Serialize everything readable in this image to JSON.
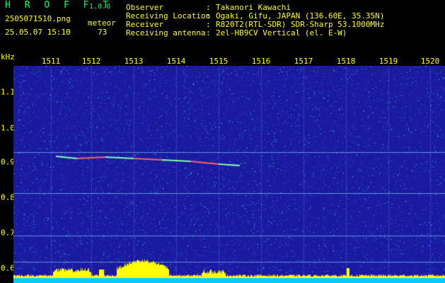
{
  "header": {
    "app_title": "H R O F F T",
    "version": "1.0.0",
    "filename": "2505071510.png",
    "datetime": "25.05.07 15:10",
    "meteor_label": "meteor",
    "meteor_count": "73"
  },
  "info": [
    {
      "label": "Observer",
      "value": "Takanori Kawachi"
    },
    {
      "label": "Receiving Location",
      "value": "Ogaki, Gifu, JAPAN (136.60E, 35.35N)"
    },
    {
      "label": "Receiver",
      "value": "R820T2(RTL-SDR) SDR-Sharp 53.1000MHz"
    },
    {
      "label": "Receiving antenna",
      "value": "2el-HB9CV Vertical (el. E-W)"
    }
  ],
  "axis": {
    "y_unit": "kHz",
    "x_ticks": [
      "1511",
      "1512",
      "1513",
      "1514",
      "1515",
      "1516",
      "1517",
      "1518",
      "1519",
      "1520"
    ],
    "y_ticks": [
      "1.1",
      "1.0",
      "0.9",
      "0.8",
      "0.7",
      "0.6"
    ]
  },
  "colors": {
    "text": "#ffff00",
    "title": "#00ff66",
    "background": "#1a1aa0",
    "bottom_bar": "#00ccff",
    "amplitude": "#ffff00"
  }
}
